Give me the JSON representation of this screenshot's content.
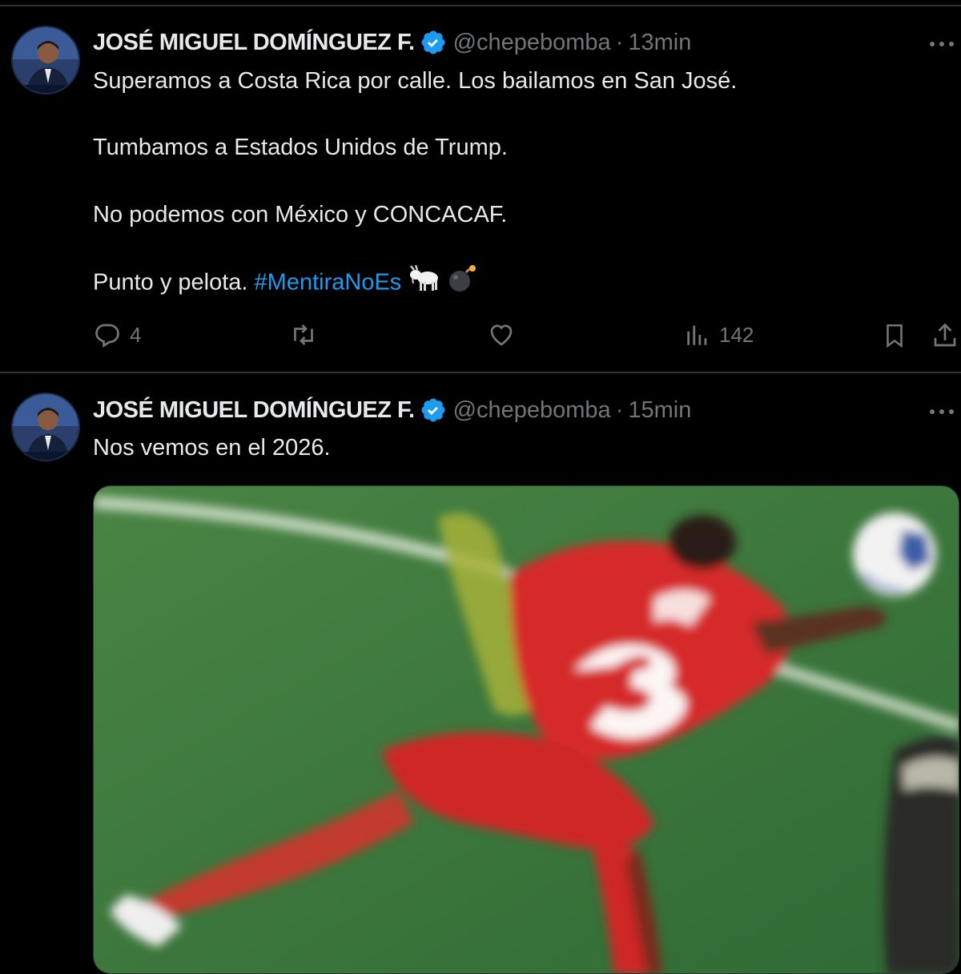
{
  "tweets": [
    {
      "author_name": "JOSÉ MIGUEL DOMÍNGUEZ F.",
      "handle": "@chepebomba",
      "separator": "·",
      "time": "13min",
      "paragraphs": [
        "Superamos a Costa Rica por calle. Los bailamos en San José.",
        "Tumbamos a Estados Unidos de Trump.",
        "No podemos con México y CONCACAF.",
        "Punto y pelota."
      ],
      "hashtag": "#MentiraNoEs",
      "emojis": [
        "goat-emoji",
        "bomb-emoji"
      ],
      "stats": {
        "replies": "4",
        "retweets": "",
        "likes": "",
        "views": "142"
      },
      "icons": [
        "reply-icon",
        "retweet-icon",
        "like-icon",
        "views-icon",
        "bookmark-icon",
        "share-icon"
      ]
    },
    {
      "author_name": "JOSÉ MIGUEL DOMÍNGUEZ F.",
      "handle": "@chepebomba",
      "separator": "·",
      "time": "15min",
      "paragraphs": [
        "Nos vemos en el 2026."
      ],
      "media": {
        "kind": "photo",
        "jersey_number": "3",
        "colors": {
          "pitch": "#3c7a3c",
          "jersey": "#d62a2a",
          "ball": "#f2f2f2"
        }
      }
    }
  ],
  "colors": {
    "background": "#000000",
    "text": "#e7e9ea",
    "muted": "#71767b",
    "accent": "#1d9bf0",
    "divider": "#2f3336"
  }
}
